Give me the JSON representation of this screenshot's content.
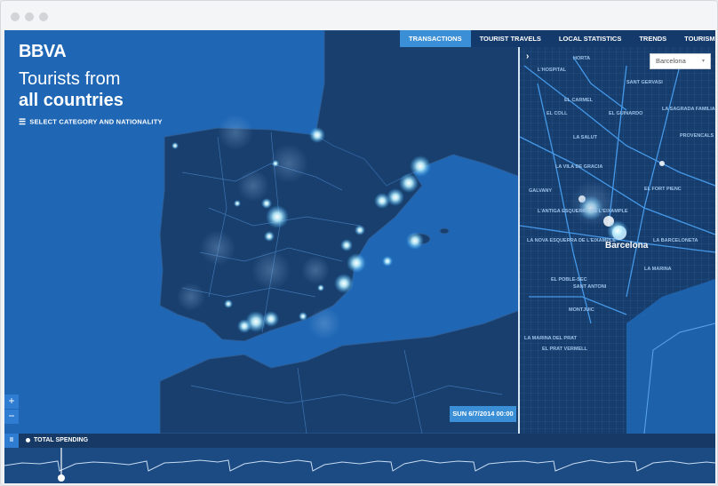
{
  "app": {
    "logo": "BBVA",
    "headline_line1": "Tourists from",
    "headline_line2": "all countries",
    "select_label": "SELECT CATEGORY AND NATIONALITY"
  },
  "nav": {
    "tabs": [
      {
        "label": "TRANSACTIONS",
        "active": true
      },
      {
        "label": "TOURIST TRAVELS",
        "active": false
      },
      {
        "label": "LOCAL STATISTICS",
        "active": false
      },
      {
        "label": "TRENDS",
        "active": false
      },
      {
        "label": "TOURISM WEIGHT",
        "active": false
      }
    ]
  },
  "city_select": {
    "value": "Barcelona"
  },
  "date_badge": "SUN 6/7/2014 00:00",
  "zoom": {
    "in": "+",
    "out": "−"
  },
  "timeline": {
    "pause": "II",
    "label": "TOTAL SPENDING"
  },
  "city_map": {
    "city_name": "Barcelona",
    "places": [
      "HORTA",
      "L'HOSPITAL",
      "EL CARMEL",
      "EL GUINARDO",
      "EL COLL",
      "LA SALUT",
      "LA VILA DE GRACIA",
      "EL FORT PIENC",
      "SANT ANTONI",
      "EL POBLE-SEC",
      "MONTJUIC",
      "LA BARCELONETA",
      "EL PRAT VERMELL",
      "LA MARINA DEL PRAT",
      "PROVENCALS DEL POBLENOU",
      "LA SAGRADA FAMILIA",
      "LA NOVA ESQUERRA DE L'EIXAMPLE",
      "L'ANTIGA ESQUERRA DE L'EIXAMPLE",
      "GALVANY",
      "SANT GERVASI",
      "LA MARINA"
    ]
  },
  "colors": {
    "sea": "#1f67b5",
    "land": "#183f6e",
    "glow": "#bff2ff",
    "accent": "#3a8fd6"
  }
}
